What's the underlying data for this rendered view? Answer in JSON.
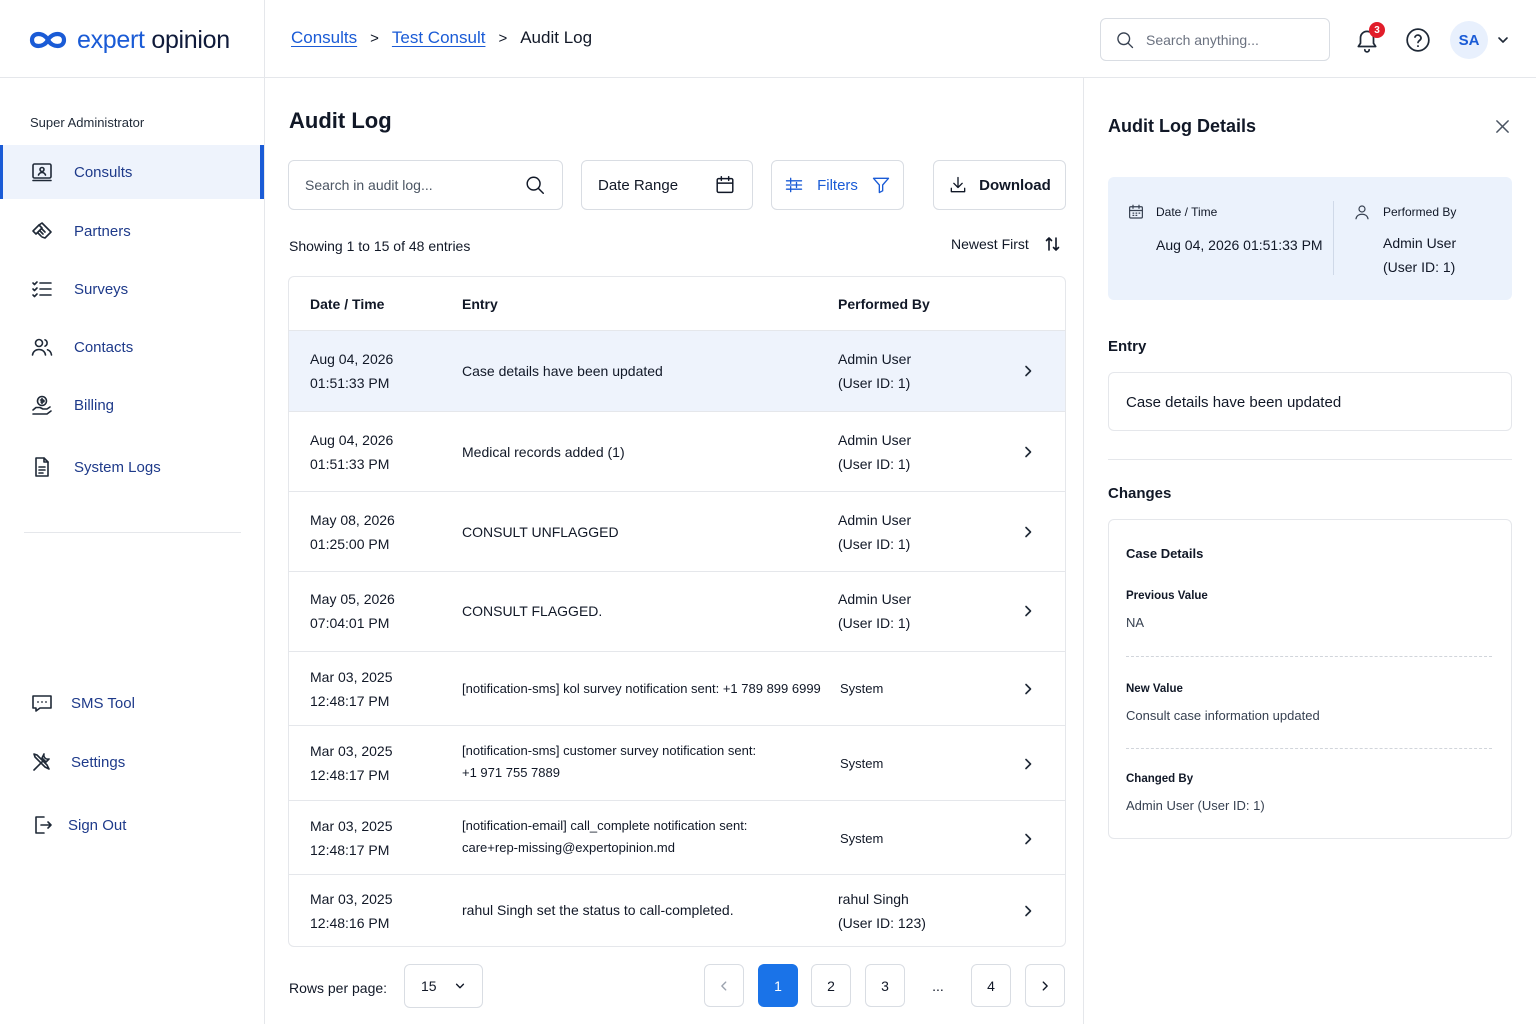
{
  "brand": {
    "name_part1": "expert",
    "name_part2": "opinion",
    "color": "#1a5bd6"
  },
  "breadcrumb": {
    "items": [
      "Consults",
      "Test Consult"
    ],
    "current": "Audit Log",
    "separator": ">"
  },
  "topbar": {
    "search_placeholder": "Search anything...",
    "notification_count": "3",
    "avatar_initials": "SA"
  },
  "sidebar": {
    "role": "Super Administrator",
    "items": [
      {
        "label": "Consults",
        "icon": "consult-icon",
        "active": true
      },
      {
        "label": "Partners",
        "icon": "handshake-icon"
      },
      {
        "label": "Surveys",
        "icon": "checklist-icon"
      },
      {
        "label": "Contacts",
        "icon": "users-icon"
      },
      {
        "label": "Billing",
        "icon": "billing-hand-icon"
      },
      {
        "label": "System Logs",
        "icon": "document-icon"
      }
    ],
    "bottom_items": [
      {
        "label": "SMS Tool",
        "icon": "sms-icon"
      },
      {
        "label": "Settings",
        "icon": "tools-icon"
      },
      {
        "label": "Sign Out",
        "icon": "sign-out-icon"
      }
    ]
  },
  "main": {
    "title": "Audit Log",
    "search_placeholder": "Search in audit log...",
    "date_range_label": "Date Range",
    "filters_label": "Filters",
    "download_label": "Download",
    "entries_info": "Showing 1 to 15 of 48 entries",
    "sort_label": "Newest First",
    "columns": [
      "Date / Time",
      "Entry",
      "Performed By"
    ],
    "rows": [
      {
        "date": "Aug 04, 2026",
        "time": "01:51:33 PM",
        "entry": "Case details have been updated",
        "by": "Admin User",
        "by_id": "(User ID: 1)"
      },
      {
        "date": "Aug 04, 2026",
        "time": "01:51:33 PM",
        "entry": "Medical records added (1)",
        "by": "Admin User",
        "by_id": "(User ID: 1)"
      },
      {
        "date": "May 08, 2026",
        "time": "01:25:00 PM",
        "entry": "CONSULT UNFLAGGED",
        "by": "Admin User",
        "by_id": "(User ID: 1)"
      },
      {
        "date": "May 05, 2026",
        "time": "07:04:01 PM",
        "entry": "CONSULT FLAGGED.",
        "by": "Admin User",
        "by_id": "(User ID: 1)"
      },
      {
        "date": "Mar 03, 2025",
        "time": "12:48:17 PM",
        "entry": "[notification-sms] kol survey notification sent: +1 789 899 6999",
        "by": "System"
      },
      {
        "date": "Mar 03, 2025",
        "time": "12:48:17 PM",
        "entry_l1": "[notification-sms] customer survey notification sent:",
        "entry_l2": "+1 971 755 7889",
        "by": "System"
      },
      {
        "date": "Mar 03, 2025",
        "time": "12:48:17 PM",
        "entry_l1": "[notification-email] call_complete notification sent:",
        "entry_l2": "care+rep-missing@expertopinion.md",
        "by": "System"
      },
      {
        "date": "Mar 03, 2025",
        "time": "12:48:16 PM",
        "entry": "rahul Singh set the status to call-completed.",
        "by": "rahul Singh",
        "by_id": "(User ID: 123)"
      }
    ],
    "rows_per_page_label": "Rows per page:",
    "rows_per_page": "15",
    "pages": [
      "1",
      "2",
      "3",
      "...",
      "4"
    ],
    "current_page": "1"
  },
  "panel": {
    "title": "Audit Log Details",
    "date_label": "Date / Time",
    "date_value": "Aug 04, 2026 01:51:33 PM",
    "by_label": "Performed By",
    "by_name": "Admin User",
    "by_id": "(User ID: 1)",
    "entry_heading": "Entry",
    "entry_value": "Case details have been updated",
    "changes_heading": "Changes",
    "changes": {
      "title": "Case Details",
      "prev_label": "Previous Value",
      "prev_value": "NA",
      "new_label": "New Value",
      "new_value": "Consult case information updated",
      "changed_by_label": "Changed By",
      "changed_by_value": "Admin User (User ID: 1)"
    }
  }
}
